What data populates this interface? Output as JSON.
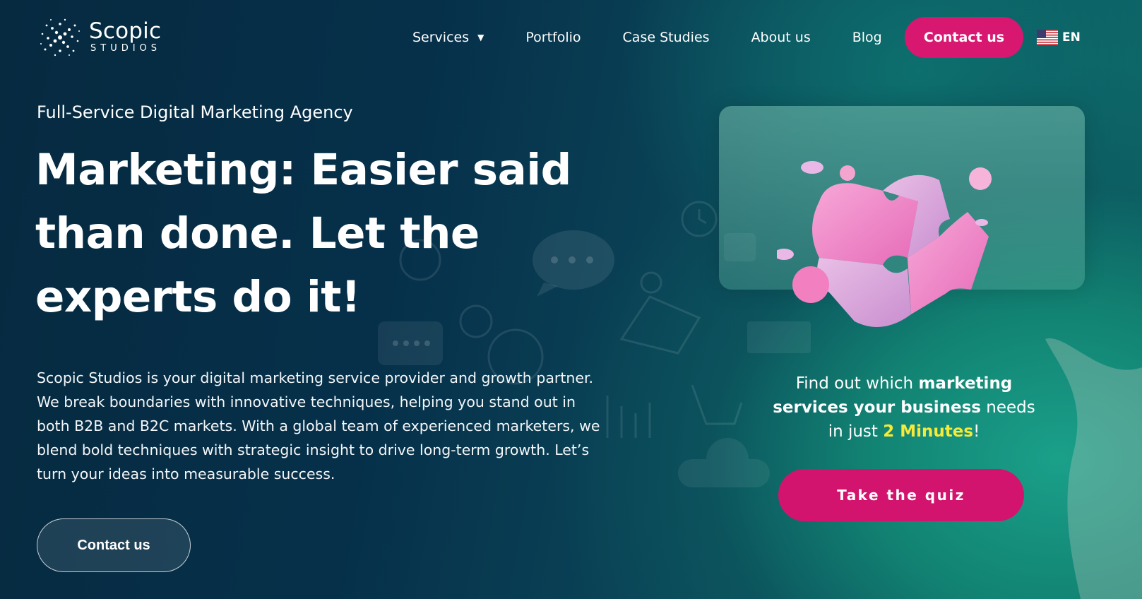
{
  "header": {
    "logo": {
      "name": "Scopic",
      "sub": "STUDIOS"
    },
    "nav": [
      {
        "label": "Services",
        "has_dropdown": true
      },
      {
        "label": "Portfolio"
      },
      {
        "label": "Case Studies"
      },
      {
        "label": "About us"
      },
      {
        "label": "Blog"
      }
    ],
    "contact_label": "Contact us",
    "language": {
      "code": "EN",
      "flag": "us-flag-icon"
    }
  },
  "hero": {
    "eyebrow": "Full-Service Digital Marketing Agency",
    "headline_lines": [
      "Marketing: Easier said",
      "than done. Let the",
      "experts do it!"
    ],
    "description": "Scopic Studios is your digital marketing service provider and growth partner. We break boundaries with innovative techniques, helping you stand out in both B2B and B2C markets. With a global team of experienced marketers, we blend bold techniques with strategic insight to drive long-term growth. Let’s turn your ideas into measurable success.",
    "contact_label": "Contact us"
  },
  "quiz": {
    "text_1": "Find out which ",
    "text_bold": "marketing services your business",
    "text_2": " needs in just ",
    "text_highlight": "2 Minutes",
    "text_3": "!",
    "button_label": "Take the quiz"
  },
  "colors": {
    "accent": "#d81770",
    "highlight": "#f5ea3a",
    "background_dark": "#062a40",
    "background_teal": "#1aa08a"
  }
}
